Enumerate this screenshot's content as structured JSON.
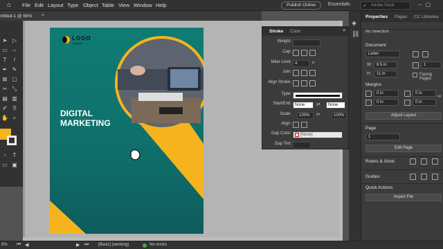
{
  "menu": {
    "items": [
      "File",
      "Edit",
      "Layout",
      "Type",
      "Object",
      "Table",
      "View",
      "Window",
      "Help"
    ]
  },
  "header": {
    "publish_label": "Publish Online",
    "workspace": "Essentials",
    "search_placeholder": "Adobe Stock"
  },
  "document": {
    "tab_title": "ntitled-1 @ 66%"
  },
  "stroke_panel": {
    "tabs": [
      "Stroke",
      "Color"
    ],
    "weight_label": "Weight:",
    "cap_label": "Cap:",
    "miter_label": "Miter Limit:",
    "miter_value": "4",
    "miter_x": "x",
    "join_label": "Join:",
    "align_label": "Align Stroke:",
    "type_label": "Type:",
    "startend_label": "Start/End:",
    "start_value": "None",
    "end_value": "None",
    "scale_label": "Scale:",
    "scale_start": "100%",
    "scale_end": "100%",
    "align2_label": "Align:",
    "gapcolor_label": "Gap Color:",
    "gapcolor_value": "[None]",
    "gaptint_label": "Gap Tint:"
  },
  "properties": {
    "tabs": [
      "Properties",
      "Pages",
      "CC Libraries"
    ],
    "selection": "No Selection",
    "document_head": "Document",
    "page_size": "Letter",
    "w_label": "W:",
    "w_value": "8.5 in",
    "h_label": "H:",
    "h_value": "11 in",
    "pages_value": "1",
    "facing_pages": "Facing Pages",
    "margins_head": "Margins",
    "margin_values": [
      "0 in",
      "0 in",
      "0 in",
      "0 in"
    ],
    "adjust_layout": "Adjust Layout",
    "page_head": "Page",
    "page_value": "1",
    "edit_page": "Edit Page",
    "rulers_head": "Rulers & Grids",
    "guides_head": "Guides",
    "quick_head": "Quick Actions",
    "import_file": "Import File"
  },
  "artboard": {
    "logo_text": "LOGO",
    "logo_sub": "Sample",
    "headline_1": "DIGITAL",
    "headline_2": "MARKETING",
    "colors": {
      "teal": "#0f7c74",
      "yellow": "#f5b41d"
    }
  },
  "status": {
    "zoom": "8%",
    "style": "[Basic] (working)",
    "preflight": "No errors"
  }
}
